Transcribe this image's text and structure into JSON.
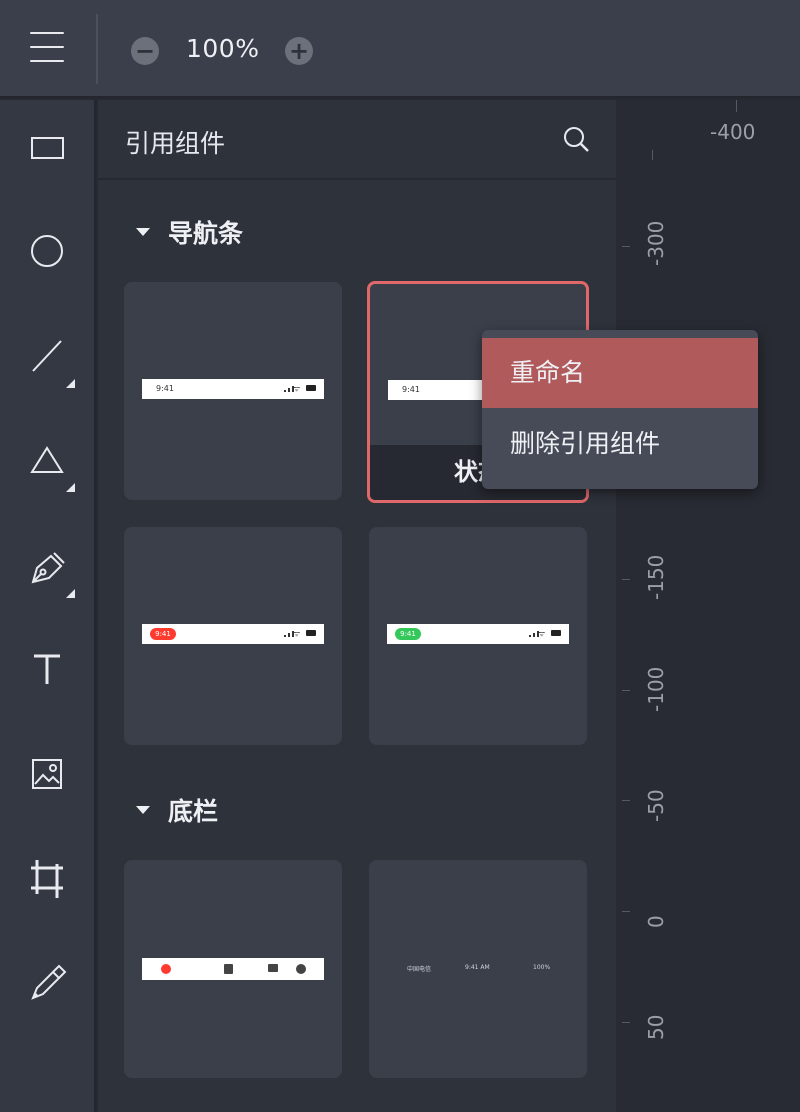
{
  "header": {
    "zoom_value": "100%",
    "zoom_out_label": "−",
    "zoom_in_label": "+"
  },
  "tools": [
    "rectangle-icon",
    "ellipse-icon",
    "line-icon",
    "triangle-icon",
    "pen-icon",
    "text-icon",
    "image-icon",
    "crop-icon",
    "eyedropper-icon"
  ],
  "panel": {
    "title": "引用组件",
    "sections": [
      {
        "label": "导航条"
      },
      {
        "label": "底栏"
      }
    ],
    "cards": {
      "card1": {
        "time": "9:41"
      },
      "card2": {
        "time": "9:41",
        "label": "状态"
      },
      "card3": {
        "time": "9:41",
        "pill_color": "#ff3b30"
      },
      "card4": {
        "time": "9:41",
        "pill_color": "#34c759"
      },
      "card6": {
        "carrier": "中国电信",
        "time": "9:41 AM",
        "battery": "100%"
      }
    }
  },
  "ruler": {
    "labels": [
      "-400",
      "-300",
      "-150",
      "-100",
      "-50",
      "0",
      "50"
    ]
  },
  "context_menu": {
    "items": [
      {
        "label": "重命名",
        "active": true
      },
      {
        "label": "删除引用组件",
        "active": false
      }
    ]
  },
  "colors": {
    "accent": "#e0686a",
    "menu_highlight": "#b15a5c"
  }
}
